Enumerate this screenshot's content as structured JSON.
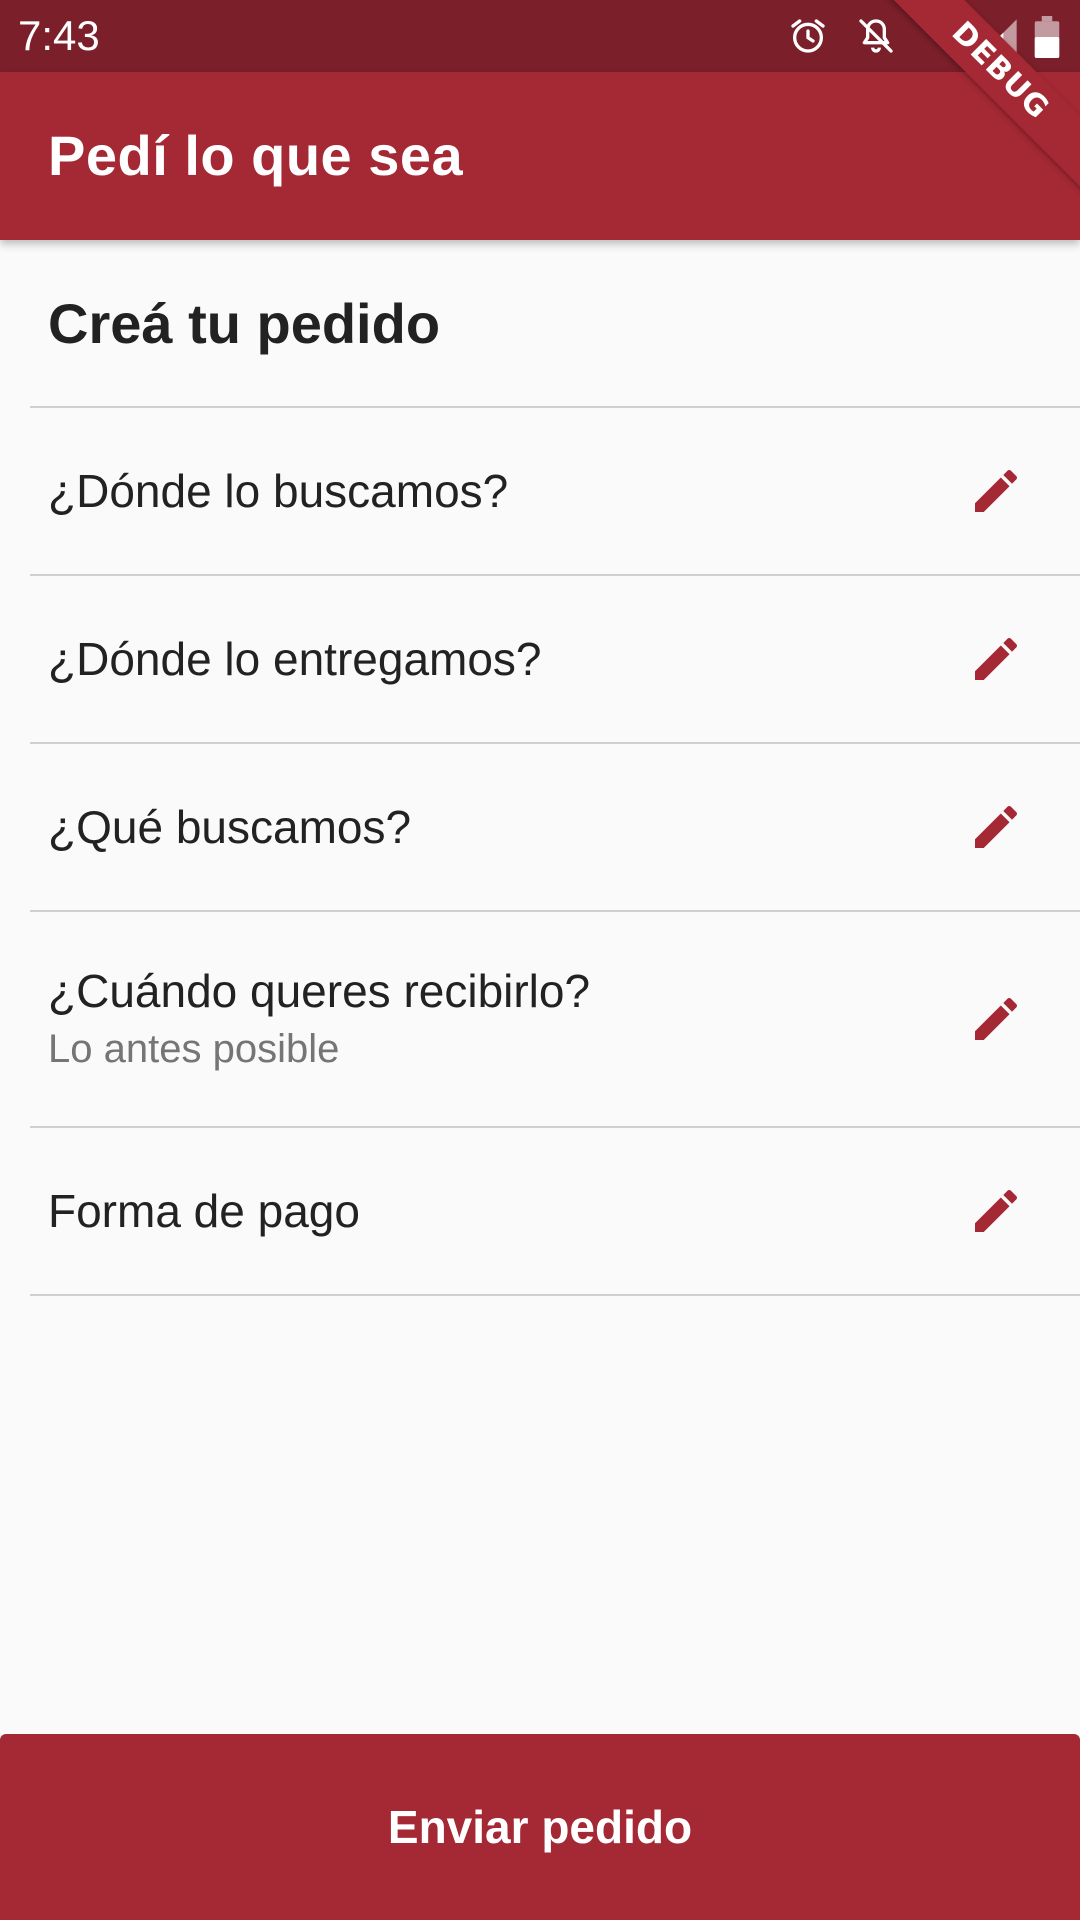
{
  "status_bar": {
    "time": "7:43",
    "icons": [
      "alarm-icon",
      "notifications-off-icon",
      "wifi-icon",
      "signal-icon",
      "battery-icon"
    ]
  },
  "debug_banner": {
    "label": "DEBUG"
  },
  "app_bar": {
    "title": "Pedí lo que sea"
  },
  "main": {
    "section_title": "Creá tu pedido",
    "items": [
      {
        "label": "¿Dónde lo buscamos?",
        "subtitle": "",
        "icon": "edit-icon"
      },
      {
        "label": "¿Dónde lo entregamos?",
        "subtitle": "",
        "icon": "edit-icon"
      },
      {
        "label": "¿Qué buscamos?",
        "subtitle": "",
        "icon": "edit-icon"
      },
      {
        "label": "¿Cuándo queres recibirlo?",
        "subtitle": "Lo antes posible",
        "icon": "edit-icon"
      },
      {
        "label": "Forma de pago",
        "subtitle": "",
        "icon": "edit-icon"
      }
    ]
  },
  "footer": {
    "submit_label": "Enviar pedido"
  },
  "colors": {
    "primary": "#a52935",
    "status_bar": "#7b1f2a",
    "background": "#fafafa",
    "text": "#222222",
    "secondary_text": "#757575",
    "divider": "#d0d0d0"
  }
}
